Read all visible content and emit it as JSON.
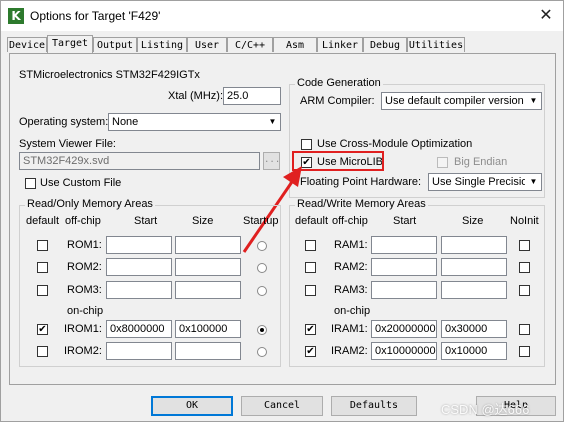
{
  "window": {
    "title": "Options for Target 'F429'",
    "icon": "keil-icon",
    "close_glyph": "✕"
  },
  "tabs": [
    "Device",
    "Target",
    "Output",
    "Listing",
    "User",
    "C/C++",
    "Asm",
    "Linker",
    "Debug",
    "Utilities"
  ],
  "active_tab": "Target",
  "target": {
    "device_name": "STMicroelectronics STM32F429IGTx",
    "xtal_label": "Xtal (MHz):",
    "xtal_value": "25.0",
    "os_label": "Operating system:",
    "os_value": "None",
    "svf_label": "System Viewer File:",
    "svf_value": "STM32F429x.svd",
    "svf_browse": "...",
    "custom_file_label": "Use Custom File"
  },
  "codegen": {
    "group_label": "Code Generation",
    "arm_compiler_label": "ARM Compiler:",
    "arm_compiler_value": "Use default compiler version",
    "cross_module_label": "Use Cross-Module Optimization",
    "microlib_label": "Use MicroLIB",
    "microlib_checked": true,
    "big_endian_label": "Big Endian",
    "fp_hw_label": "Floating Point Hardware:",
    "fp_hw_value": "Use Single Precision"
  },
  "ro_memory": {
    "group_label": "Read/Only Memory Areas",
    "headers": {
      "default": "default",
      "offchip": "off-chip",
      "start": "Start",
      "size": "Size",
      "startup": "Startup"
    },
    "onchip_label": "on-chip",
    "rows": [
      {
        "label": "ROM1:",
        "start": "",
        "size": "",
        "default": false,
        "startup": false
      },
      {
        "label": "ROM2:",
        "start": "",
        "size": "",
        "default": false,
        "startup": false
      },
      {
        "label": "ROM3:",
        "start": "",
        "size": "",
        "default": false,
        "startup": false
      },
      {
        "label": "IROM1:",
        "start": "0x8000000",
        "size": "0x100000",
        "default": true,
        "startup": true
      },
      {
        "label": "IROM2:",
        "start": "",
        "size": "",
        "default": false,
        "startup": false
      }
    ]
  },
  "rw_memory": {
    "group_label": "Read/Write Memory Areas",
    "headers": {
      "default": "default",
      "offchip": "off-chip",
      "start": "Start",
      "size": "Size",
      "noinit": "NoInit"
    },
    "onchip_label": "on-chip",
    "rows": [
      {
        "label": "RAM1:",
        "start": "",
        "size": "",
        "default": false,
        "noinit": false
      },
      {
        "label": "RAM2:",
        "start": "",
        "size": "",
        "default": false,
        "noinit": false
      },
      {
        "label": "RAM3:",
        "start": "",
        "size": "",
        "default": false,
        "noinit": false
      },
      {
        "label": "IRAM1:",
        "start": "0x20000000",
        "size": "0x30000",
        "default": true,
        "noinit": false
      },
      {
        "label": "IRAM2:",
        "start": "0x10000000",
        "size": "0x10000",
        "default": true,
        "noinit": false
      }
    ]
  },
  "buttons": {
    "ok": "OK",
    "cancel": "Cancel",
    "defaults": "Defaults",
    "help": "Help"
  },
  "watermark": "CSDN @达666",
  "colors": {
    "highlight": "#e02020"
  }
}
